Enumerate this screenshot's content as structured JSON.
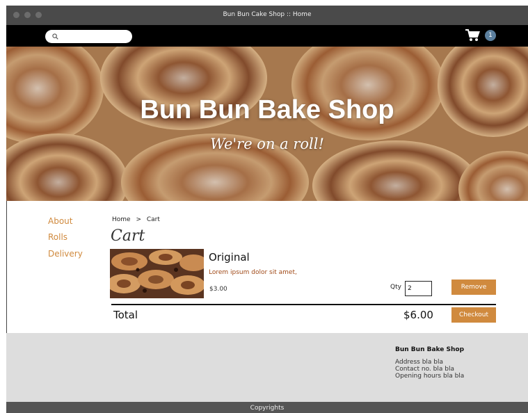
{
  "window": {
    "title": "Bun Bun Cake Shop :: Home"
  },
  "navbar": {
    "search_placeholder": "",
    "cart_count": "1"
  },
  "hero": {
    "title": "Bun Bun Bake Shop",
    "tagline": "We're on a roll!"
  },
  "sidebar": {
    "items": [
      {
        "label": "About"
      },
      {
        "label": "Rolls"
      },
      {
        "label": "Delivery"
      }
    ]
  },
  "breadcrumb": {
    "home": "Home",
    "separator": ">",
    "current": "Cart"
  },
  "cart": {
    "heading": "Cart",
    "item": {
      "name": "Original",
      "description": "Lorem ipsum dolor sit amet,",
      "price": "$3.00",
      "qty_label": "Qty",
      "qty_value": "2",
      "remove_label": "Remove"
    },
    "total_label": "Total",
    "total_value": "$6.00",
    "checkout_label": "Checkout"
  },
  "footer": {
    "name": "Bun Bun Bake Shop",
    "lines": [
      "Address bla bla",
      "Contact no. bla bla",
      "Opening hours bla bla"
    ],
    "copyright": "Copyrights"
  },
  "colors": {
    "accent": "#d08a3e",
    "badge": "#5b7f9e",
    "navbar": "#000000",
    "footer": "#dddddd"
  },
  "icons": {
    "search": "search-icon",
    "cart": "cart-icon"
  }
}
